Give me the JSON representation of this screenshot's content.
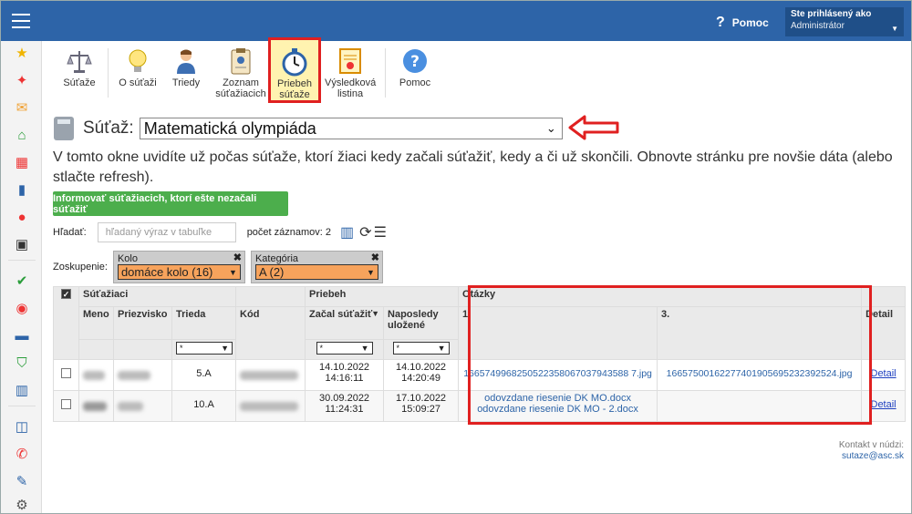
{
  "topbar": {
    "help_label": "Pomoc",
    "user_label": "Ste prihlásený ako",
    "user_value": "Administrátor"
  },
  "sidebar": {
    "icons": [
      "star-icon",
      "magic-wand-icon",
      "mail-icon",
      "home-icon",
      "calendar-grid-icon",
      "book-icon",
      "user-circle-icon",
      "calendar-icon",
      "check-circle-icon",
      "stats-circle-icon",
      "briefcase-icon",
      "shield-icon",
      "bar-chart-icon",
      "open-book-icon",
      "chat-icon",
      "pen-icon",
      "gear-icon"
    ],
    "colors": {
      "star": "#f0b400",
      "red": "#e33",
      "green": "#2a9d3a",
      "blue": "#2d64a8"
    }
  },
  "toolbar": {
    "items": [
      {
        "label": "Súťaže",
        "icon": "scales-icon"
      },
      {
        "label": "O súťaži",
        "icon": "lightbulb-icon"
      },
      {
        "label": "Triedy",
        "icon": "person-icon"
      },
      {
        "label": "Zoznam súťažiacich",
        "icon": "clipboard-icon"
      },
      {
        "label": "Priebeh súťaže",
        "icon": "stopwatch-icon",
        "active": true
      },
      {
        "label": "Výsledková listina",
        "icon": "certificate-icon"
      },
      {
        "label": "Pomoc",
        "icon": "help-circle-icon"
      }
    ]
  },
  "competition": {
    "label": "Súťaž:",
    "selected": "Matematická olympiáda"
  },
  "info_text": "V tomto okne uvidíte už počas súťaže, ktorí žiaci kedy začali súťažiť, kedy a či už skončili. Obnovte stránku pre novšie dáta (alebo stlačte refresh).",
  "notify_button": "Informovať súťažiacich, ktorí ešte nezačali súťažiť",
  "search": {
    "label": "Hľadať:",
    "placeholder": "hľadaný výraz v tabuľke",
    "count_label": "počet záznamov: 2"
  },
  "grouping": {
    "label": "Zoskupenie:",
    "kolo": {
      "label": "Kolo",
      "value": "domáce kolo (16)"
    },
    "kategoria": {
      "label": "Kategória",
      "value": "A (2)"
    }
  },
  "table": {
    "group_headers": {
      "students": "Súťažiaci",
      "progress": "Priebeh",
      "questions": "Otázky"
    },
    "columns": {
      "meno": "Meno",
      "priezvisko": "Priezvisko",
      "trieda": "Trieda",
      "kod": "Kód",
      "zacal": "Začal súťažiť",
      "naposledy": "Naposledy uložené",
      "q1": "1.",
      "q3": "3.",
      "detail": "Detail"
    },
    "filter_value": "*",
    "rows": [
      {
        "trieda": "5.A",
        "zacal_date": "14.10.2022",
        "zacal_time": "14:16:11",
        "ulozene_date": "14.10.2022",
        "ulozene_time": "14:20:49",
        "q1": [
          "1665749968250522358067037943588 7.jpg"
        ],
        "q3": "16657500162277401905695232392524.jpg",
        "detail": "Detail"
      },
      {
        "trieda": "10.A",
        "zacal_date": "30.09.2022",
        "zacal_time": "11:24:31",
        "ulozene_date": "17.10.2022",
        "ulozene_time": "15:09:27",
        "q1": [
          "odovzdane riesenie DK MO.docx",
          "odovzdane riesenie DK MO - 2.docx"
        ],
        "q3": "",
        "detail": "Detail"
      }
    ]
  },
  "contact": {
    "label": "Kontakt v núdzi:",
    "email": "sutaze@asc.sk"
  }
}
